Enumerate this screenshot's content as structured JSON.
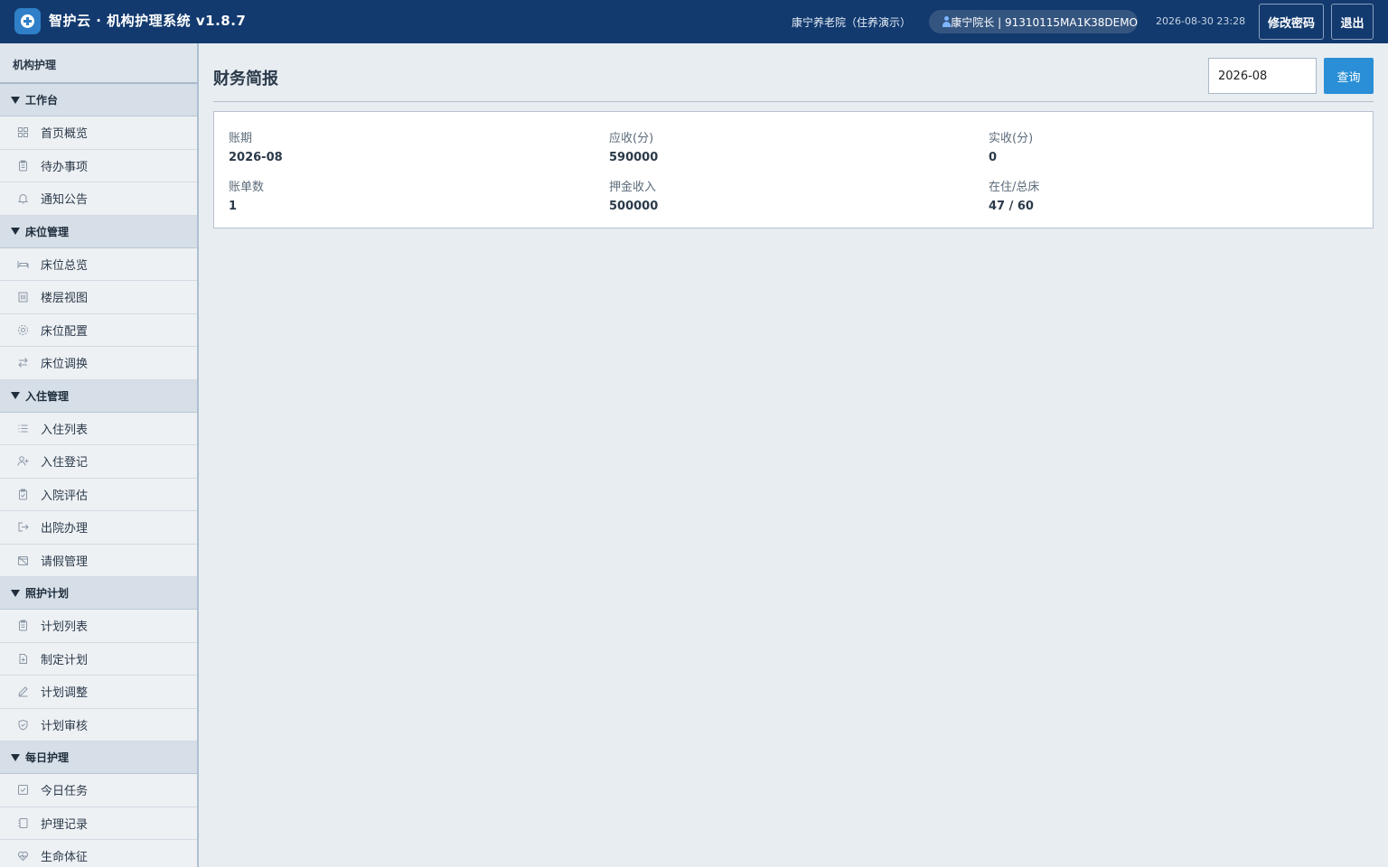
{
  "header": {
    "app_title": "智护云 · 机构护理系统 v1.8.7",
    "org_name": "康宁养老院（住养演示）",
    "user_label": "康宁院长 | 91310115MA1K38DEMO",
    "datetime": "2026-08-30 23:28",
    "change_password_label": "修改密码",
    "logout_label": "退出"
  },
  "sidebar": {
    "top_label": "机构护理",
    "sections": [
      {
        "title": "工作台",
        "items": [
          {
            "label": "首页概览",
            "icon": "grid-icon"
          },
          {
            "label": "待办事项",
            "icon": "clipboard-icon"
          },
          {
            "label": "通知公告",
            "icon": "bell-icon"
          }
        ]
      },
      {
        "title": "床位管理",
        "items": [
          {
            "label": "床位总览",
            "icon": "bed-icon"
          },
          {
            "label": "楼层视图",
            "icon": "building-icon"
          },
          {
            "label": "床位配置",
            "icon": "gear-icon"
          },
          {
            "label": "床位调换",
            "icon": "swap-icon"
          }
        ]
      },
      {
        "title": "入住管理",
        "items": [
          {
            "label": "入住列表",
            "icon": "list-icon"
          },
          {
            "label": "入住登记",
            "icon": "user-plus-icon"
          },
          {
            "label": "入院评估",
            "icon": "clipboard-check-icon"
          },
          {
            "label": "出院办理",
            "icon": "exit-icon"
          },
          {
            "label": "请假管理",
            "icon": "calendar-off-icon"
          }
        ]
      },
      {
        "title": "照护计划",
        "items": [
          {
            "label": "计划列表",
            "icon": "clipboard-icon"
          },
          {
            "label": "制定计划",
            "icon": "file-plus-icon"
          },
          {
            "label": "计划调整",
            "icon": "pen-icon"
          },
          {
            "label": "计划审核",
            "icon": "shield-check-icon"
          }
        ]
      },
      {
        "title": "每日护理",
        "items": [
          {
            "label": "今日任务",
            "icon": "checkbox-icon"
          },
          {
            "label": "护理记录",
            "icon": "notebook-icon"
          },
          {
            "label": "生命体征",
            "icon": "heart-pulse-icon"
          }
        ]
      }
    ]
  },
  "main": {
    "title": "财务简报",
    "month_value": "2026-08",
    "query_label": "查询",
    "stats": [
      {
        "label": "账期",
        "value": "2026-08"
      },
      {
        "label": "应收(分)",
        "value": "590000"
      },
      {
        "label": "实收(分)",
        "value": "0"
      },
      {
        "label": "账单数",
        "value": "1"
      },
      {
        "label": "押金收入",
        "value": "500000"
      },
      {
        "label": "在住/总床",
        "value": "47 / 60"
      }
    ]
  },
  "colors": {
    "header_bg": "#123a6f",
    "accent": "#2a8fd6",
    "page_bg": "#e8edf2"
  }
}
